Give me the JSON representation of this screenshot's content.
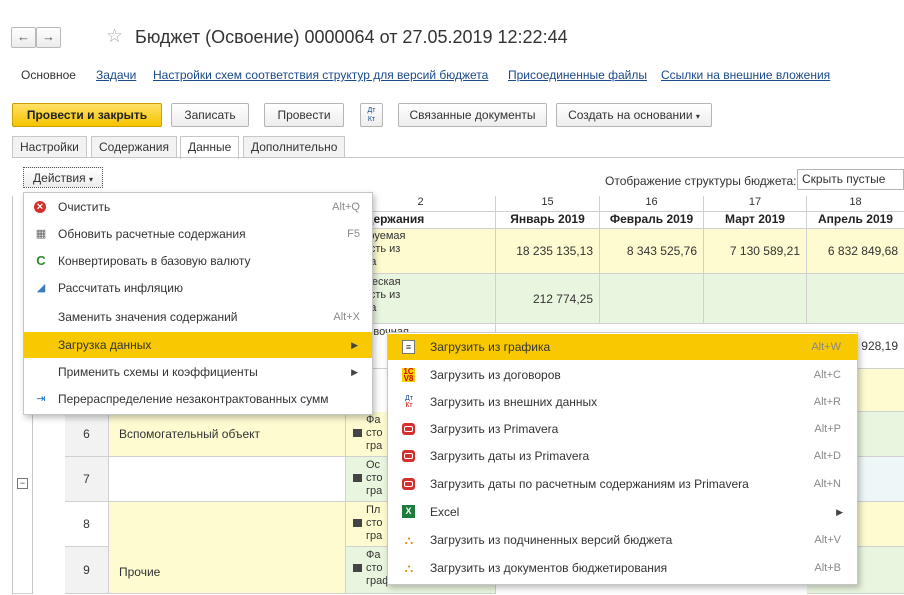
{
  "header": {
    "title": "Бюджет (Освоение) 0000064 от 27.05.2019 12:22:44",
    "back": "←",
    "forward": "→",
    "star": "☆"
  },
  "command_panel": {
    "main": "Основное",
    "links": [
      "Задачи",
      "Настройки схем соответствия структур для версий бюджета",
      "Присоединенные файлы",
      "Ссылки на внешние вложения"
    ]
  },
  "toolbar": {
    "post_close": "Провести и закрыть",
    "save": "Записать",
    "post": "Провести",
    "dtkt": "Дт Кт",
    "related": "Связанные документы",
    "create_basis": "Создать на основании"
  },
  "tabs": [
    "Настройки",
    "Содержания",
    "Данные",
    "Дополнительно"
  ],
  "actions_label": "Действия",
  "structure_label": "Отображение структуры бюджета:",
  "structure_value": "Скрыть пустые",
  "table": {
    "col_numbers": [
      "2",
      "15",
      "16",
      "17",
      "18"
    ],
    "col_names": [
      "Содержания",
      "Январь 2019",
      "Февраль 2019",
      "Март 2019",
      "Апрель 2019"
    ],
    "rows_top": [
      {
        "content": "анируемая\nимость из\nфика",
        "values": [
          "18 235 135,13",
          "8 343 525,76",
          "7 130 589,21",
          "6 832 849,68"
        ]
      },
      {
        "content": "ктическая\nимость из\nфика",
        "values": [
          "212 774,25",
          "",
          "",
          ""
        ]
      },
      {
        "content": "тировочная",
        "values": [
          "",
          "",
          "",
          "9 928,19"
        ]
      }
    ],
    "rows_bottom": [
      {
        "num": "6",
        "name": "Вспомогательный объект",
        "content": "Фа\nсто\nгра"
      },
      {
        "num": "7",
        "name": "",
        "content": "Ос\nсто\nгра"
      },
      {
        "num": "8",
        "name": "",
        "content": "Пл\nсто\nгра"
      },
      {
        "num": "9",
        "name": "Прочие",
        "content": "Фа\nсто\nграфика"
      }
    ]
  },
  "actions_menu": [
    {
      "icon": "clear-icon",
      "label": "Очистить",
      "shortcut": "Alt+Q"
    },
    {
      "icon": "refresh-icon",
      "label": "Обновить расчетные содержания",
      "shortcut": "F5"
    },
    {
      "icon": "convert-icon",
      "label": "Конвертировать в базовую валюту",
      "shortcut": ""
    },
    {
      "icon": "inflation-icon",
      "label": "Рассчитать инфляцию",
      "shortcut": ""
    },
    {
      "icon": "",
      "label": "Заменить значения содержаний",
      "shortcut": "Alt+X"
    },
    {
      "icon": "",
      "label": "Загрузка данных",
      "shortcut": "",
      "submenu": true
    },
    {
      "icon": "",
      "label": "Применить схемы и коэффициенты",
      "shortcut": "",
      "submenu": true
    },
    {
      "icon": "redistribute-icon",
      "label": "Перераспределение незаконтрактованных сумм",
      "shortcut": ""
    }
  ],
  "load_submenu": [
    {
      "icon": "schedule-icon",
      "label": "Загрузить из графика",
      "shortcut": "Alt+W"
    },
    {
      "icon": "1c-icon",
      "label": "Загрузить из договоров",
      "shortcut": "Alt+C"
    },
    {
      "icon": "dtkt-icon",
      "label": "Загрузить из внешних данных",
      "shortcut": "Alt+R"
    },
    {
      "icon": "primavera-icon",
      "label": "Загрузить из Primavera",
      "shortcut": "Alt+P"
    },
    {
      "icon": "primavera-icon",
      "label": "Загрузить даты из Primavera",
      "shortcut": "Alt+D"
    },
    {
      "icon": "primavera-icon",
      "label": "Загрузить даты по расчетным содержаниям из Primavera",
      "shortcut": "Alt+N"
    },
    {
      "icon": "excel-icon",
      "label": "Excel",
      "shortcut": "",
      "submenu": true
    },
    {
      "icon": "hierarchy-icon",
      "label": "Загрузить из подчиненных версий бюджета",
      "shortcut": "Alt+V"
    },
    {
      "icon": "hierarchy-icon",
      "label": "Загрузить из документов бюджетирования",
      "shortcut": "Alt+B"
    }
  ]
}
